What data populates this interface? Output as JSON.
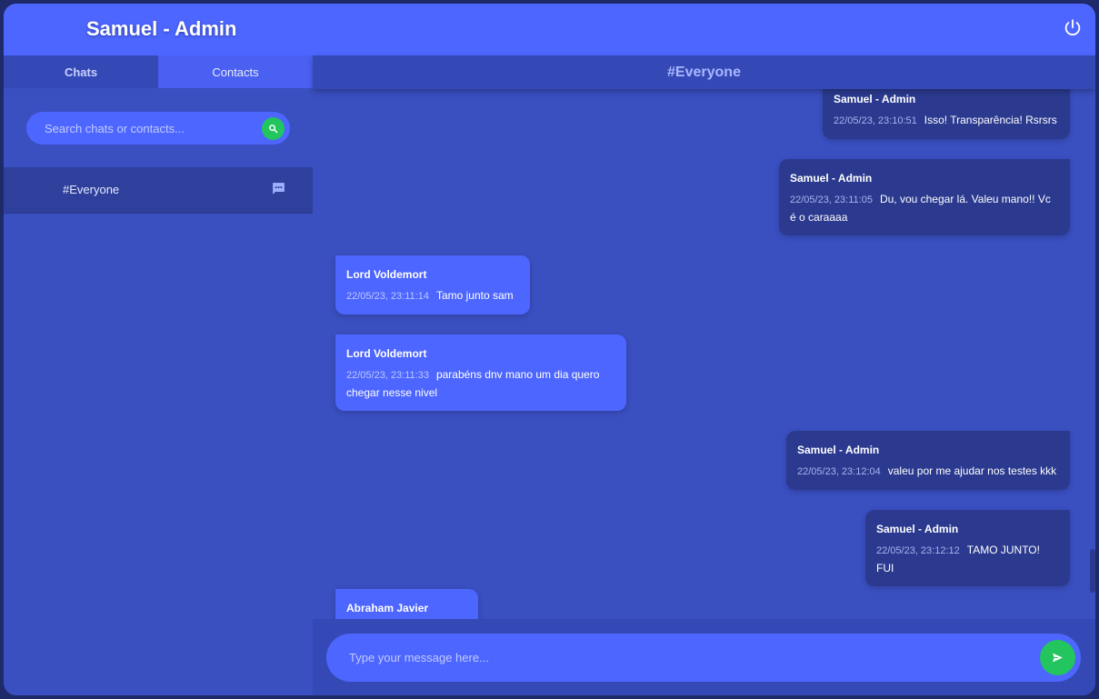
{
  "header": {
    "title": "Samuel - Admin",
    "power_icon": "power-icon"
  },
  "sidebar": {
    "tabs": [
      {
        "label": "Chats",
        "active": true
      },
      {
        "label": "Contacts",
        "active": false
      }
    ],
    "search": {
      "placeholder": "Search chats or contacts...",
      "value": "",
      "icon": "search-icon"
    },
    "chats": [
      {
        "name": "#Everyone",
        "icon": "chat-bubble-icon"
      }
    ]
  },
  "room": {
    "title": "#Everyone"
  },
  "messages": [
    {
      "author": "Samuel - Admin",
      "time": "22/05/23, 23:10:51",
      "text": "Isso! Transparência! Rsrsrs",
      "mine": true
    },
    {
      "author": "Samuel - Admin",
      "time": "22/05/23, 23:11:05",
      "text": "Du, vou chegar lá. Valeu mano!! Vc é o caraaaa",
      "mine": true
    },
    {
      "author": "Lord Voldemort",
      "time": "22/05/23, 23:11:14",
      "text": "Tamo junto sam",
      "mine": false
    },
    {
      "author": "Lord Voldemort",
      "time": "22/05/23, 23:11:33",
      "text": "parabéns dnv mano um dia quero chegar nesse nivel",
      "mine": false
    },
    {
      "author": "Samuel - Admin",
      "time": "22/05/23, 23:12:04",
      "text": "valeu por me ajudar nos testes kkk",
      "mine": true
    },
    {
      "author": "Samuel - Admin",
      "time": "22/05/23, 23:12:12",
      "text": "TAMO JUNTO! FUI",
      "mine": true
    },
    {
      "author": "Abraham Javier",
      "time": "",
      "text": "",
      "mine": false
    }
  ],
  "composer": {
    "placeholder": "Type your message here...",
    "value": "",
    "send_icon": "send-icon"
  },
  "colors": {
    "header_bg": "#4d66ff",
    "panel_bg": "#3a4fc0",
    "own_message_bg": "#2b3a8f",
    "other_message_bg": "#4d66ff",
    "accent_green": "#22c55e"
  }
}
